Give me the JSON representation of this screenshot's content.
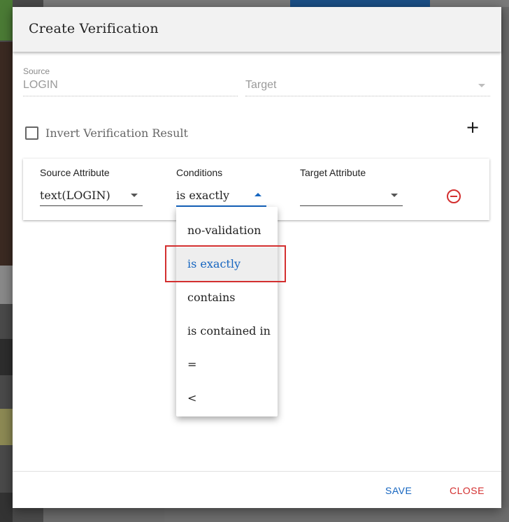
{
  "dialog": {
    "title": "Create Verification"
  },
  "source": {
    "label": "Source",
    "value": "LOGIN"
  },
  "target": {
    "placeholder": "Target"
  },
  "invert": {
    "label": "Invert Verification Result",
    "checked": false
  },
  "condition_row": {
    "source_attribute_header": "Source Attribute",
    "conditions_header": "Conditions",
    "target_attribute_header": "Target Attribute",
    "source_attribute_value": "text(LOGIN)",
    "condition_value": "is exactly",
    "target_attribute_value": ""
  },
  "dropdown": {
    "options": [
      "no-validation",
      "is exactly",
      "contains",
      "is contained in",
      "=",
      "<"
    ],
    "selected": "is exactly"
  },
  "footer": {
    "save_label": "SAVE",
    "close_label": "CLOSE"
  },
  "icons": {
    "add": "plus-icon",
    "remove": "remove-circle-icon"
  },
  "colors": {
    "primary": "#1565c0",
    "danger": "#d32f2f"
  }
}
